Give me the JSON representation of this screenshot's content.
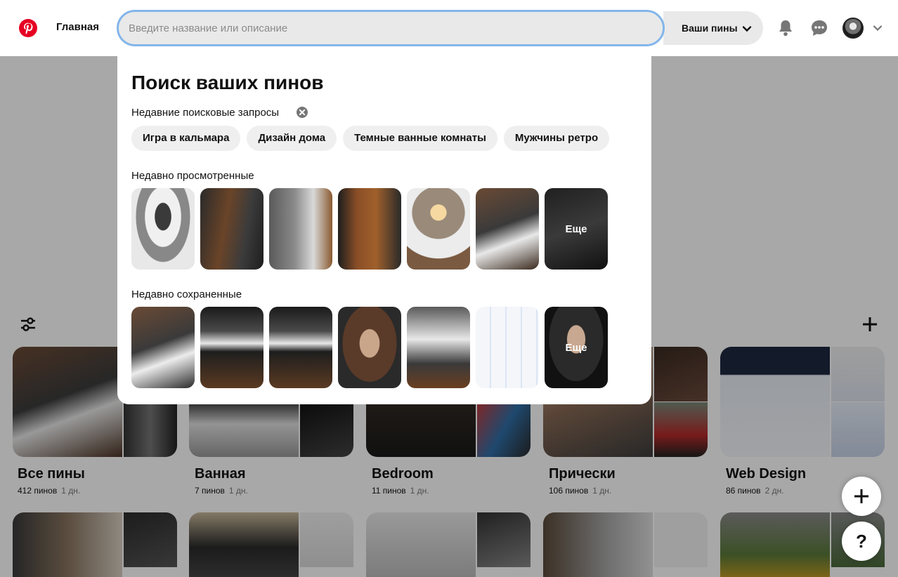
{
  "header": {
    "home_label": "Главная",
    "search_placeholder": "Введите название или описание",
    "scope_label": "Ваши пины",
    "icons": [
      "pinterest-logo-icon",
      "bell-icon",
      "message-icon",
      "avatar",
      "chevron-down-icon"
    ]
  },
  "panel": {
    "title": "Поиск ваших пинов",
    "recent_searches_label": "Недавние поисковые запросы",
    "recent_searches": [
      "Игра в кальмара",
      "Дизайн дома",
      "Темные ванные комнаты",
      "Мужчины ретро"
    ],
    "recently_viewed_label": "Недавно просмотренные",
    "recently_saved_label": "Недавно сохраненные",
    "more_label": "Еще"
  },
  "boards": [
    {
      "title": "Все пины",
      "count": "412 пинов",
      "age": "1 дн."
    },
    {
      "title": "Ванная",
      "count": "7 пинов",
      "age": "1 дн."
    },
    {
      "title": "Bedroom",
      "count": "11 пинов",
      "age": "1 дн."
    },
    {
      "title": "Прически",
      "count": "106 пинов",
      "age": "1 дн."
    },
    {
      "title": "Web Design",
      "count": "86 пинов",
      "age": "2 дн."
    }
  ],
  "fab": {
    "help_label": "?"
  },
  "colors": {
    "brand": "#e60023",
    "focus_ring": "#83b6ea",
    "chip_bg": "#efefef",
    "overlay": "rgba(0,0,0,0.34)"
  }
}
